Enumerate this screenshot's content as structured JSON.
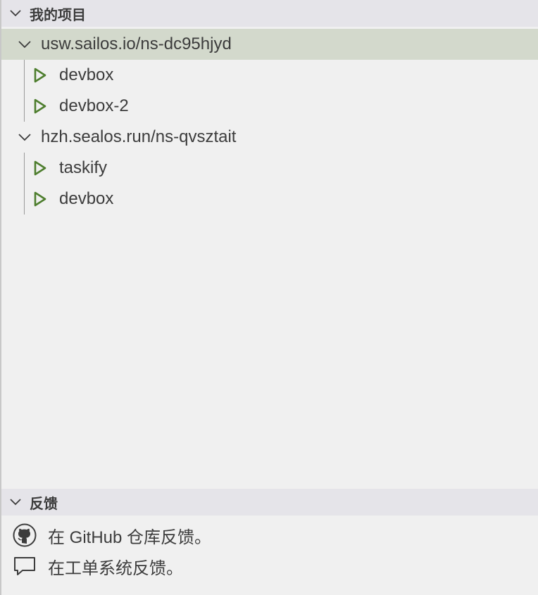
{
  "sections": {
    "projects": {
      "title": "我的项目",
      "groups": [
        {
          "label": "usw.sailos.io/ns-dc95hjyd",
          "items": [
            "devbox",
            "devbox-2"
          ]
        },
        {
          "label": "hzh.sealos.run/ns-qvsztait",
          "items": [
            "taskify",
            "devbox"
          ]
        }
      ]
    },
    "feedback": {
      "title": "反馈",
      "items": [
        {
          "label": "在 GitHub 仓库反馈。",
          "icon": "github-icon"
        },
        {
          "label": "在工单系统反馈。",
          "icon": "comment-icon"
        }
      ]
    }
  },
  "colors": {
    "play": "#4e7e2e",
    "selected_row": "#d3d9cc",
    "header_bg": "#e5e4e9",
    "background": "#f0f0f0"
  }
}
